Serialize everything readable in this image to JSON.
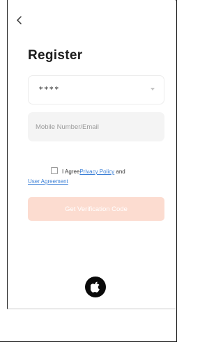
{
  "nav": {
    "back_icon": "chevron-left-icon"
  },
  "page": {
    "title": "Register"
  },
  "region_select": {
    "value": "****",
    "icon": "caret-down-icon"
  },
  "account_input": {
    "placeholder": "Mobile Number/Email",
    "value": ""
  },
  "agreement": {
    "checked": false,
    "prefix": "I Agree",
    "privacy_link": "Privacy Policy",
    "connector": " and",
    "user_agreement_link": "User Agreement"
  },
  "cta": {
    "label": "Get Verification Code",
    "color": "#fcdcd0"
  },
  "social": {
    "apple_icon": "apple-logo-icon"
  },
  "colors": {
    "accent_link": "#3b7fd6",
    "cta_disabled": "#fcdcd0",
    "input_bg": "#f4f4f4"
  }
}
